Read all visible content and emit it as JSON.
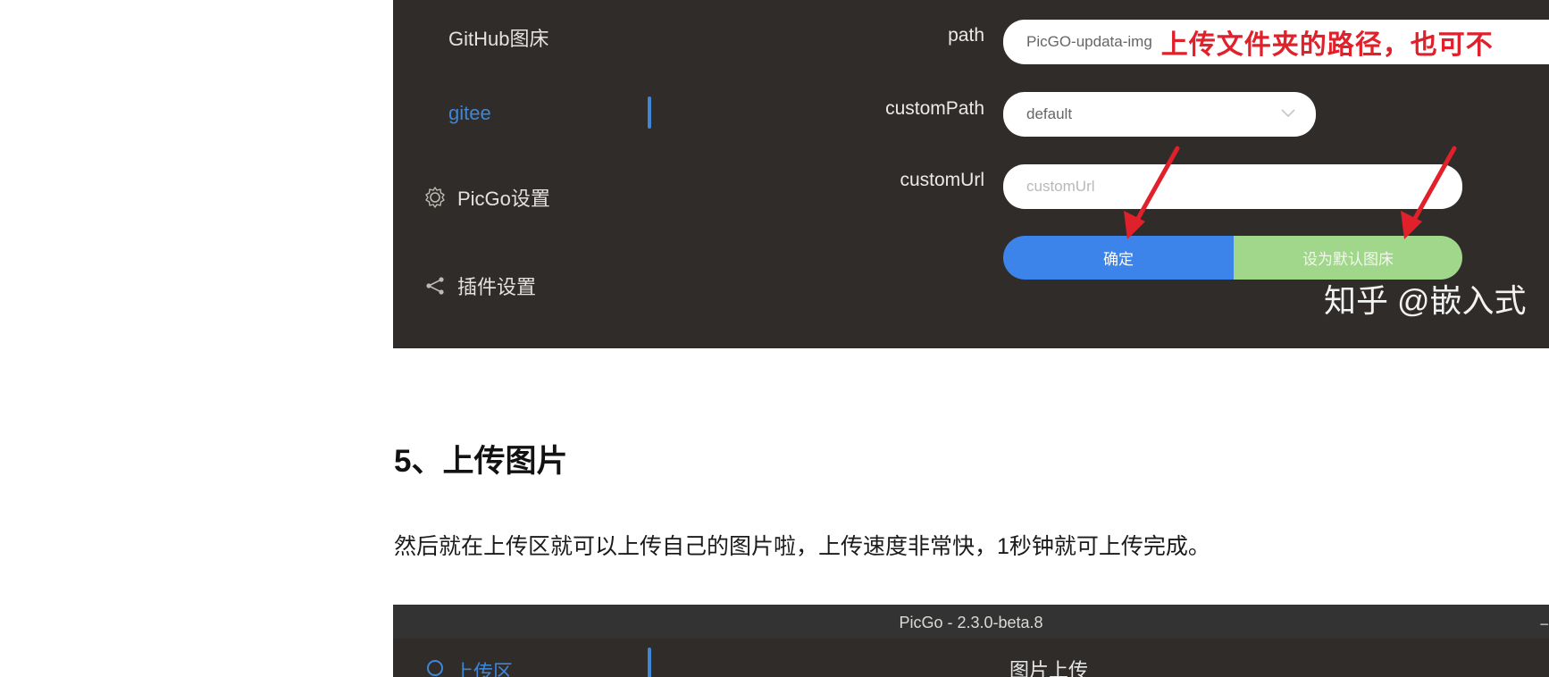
{
  "top_screenshot": {
    "sidebar": {
      "items": [
        {
          "label": "GitHub图床"
        },
        {
          "label": "gitee"
        },
        {
          "label": "PicGo设置"
        },
        {
          "label": "插件设置"
        }
      ]
    },
    "form": {
      "path": {
        "label": "path",
        "value": "PicGO-updata-img",
        "annotation": "上传文件夹的路径，也可不"
      },
      "customPath": {
        "label": "customPath",
        "value": "default"
      },
      "customUrl": {
        "label": "customUrl",
        "placeholder": "customUrl"
      },
      "confirm_label": "确定",
      "set_default_label": "设为默认图床"
    },
    "watermark": "知乎 @嵌入式"
  },
  "article": {
    "heading": "5、上传图片",
    "paragraph": "然后就在上传区就可以上传自己的图片啦，上传速度非常快，1秒钟就可上传完成。"
  },
  "bottom_screenshot": {
    "window_title": "PicGo - 2.3.0-beta.8",
    "minimize_glyph": "−",
    "sidebar_item": "上传区",
    "main_heading": "图片上传"
  },
  "colors": {
    "panel_bg": "#2f2c29",
    "accent_blue": "#3f86d6",
    "confirm_blue": "#3c84ea",
    "default_green": "#a0d78a",
    "annotation_red": "#e0202a"
  },
  "icons": [
    "gear-icon",
    "share-icon",
    "chevron-down-icon",
    "upload-icon"
  ]
}
